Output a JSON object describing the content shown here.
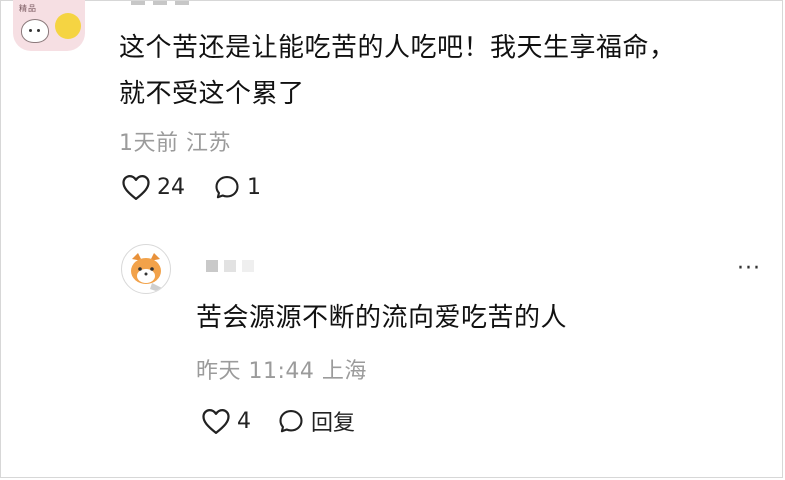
{
  "top_comment": {
    "text_line1": "这个苦还是让能吃苦的人吃吧！我天生享福命，",
    "text_line2": "就不受这个累了",
    "time": "1天前",
    "location": "江苏",
    "likes": "24",
    "replies": "1"
  },
  "reply": {
    "text": "苦会源源不断的流向爱吃苦的人",
    "time": "昨天 11:44",
    "location": "上海",
    "likes": "4",
    "reply_label": "回复",
    "more_label": "···"
  },
  "icons": {
    "like": "heart-outline-icon",
    "comment": "speech-bubble-icon",
    "more": "more-dots-icon"
  },
  "colors": {
    "text": "#111111",
    "meta": "#9b9b9b",
    "avatar_bg": "#f6dfe3",
    "heart_badge": "#f5d442"
  }
}
